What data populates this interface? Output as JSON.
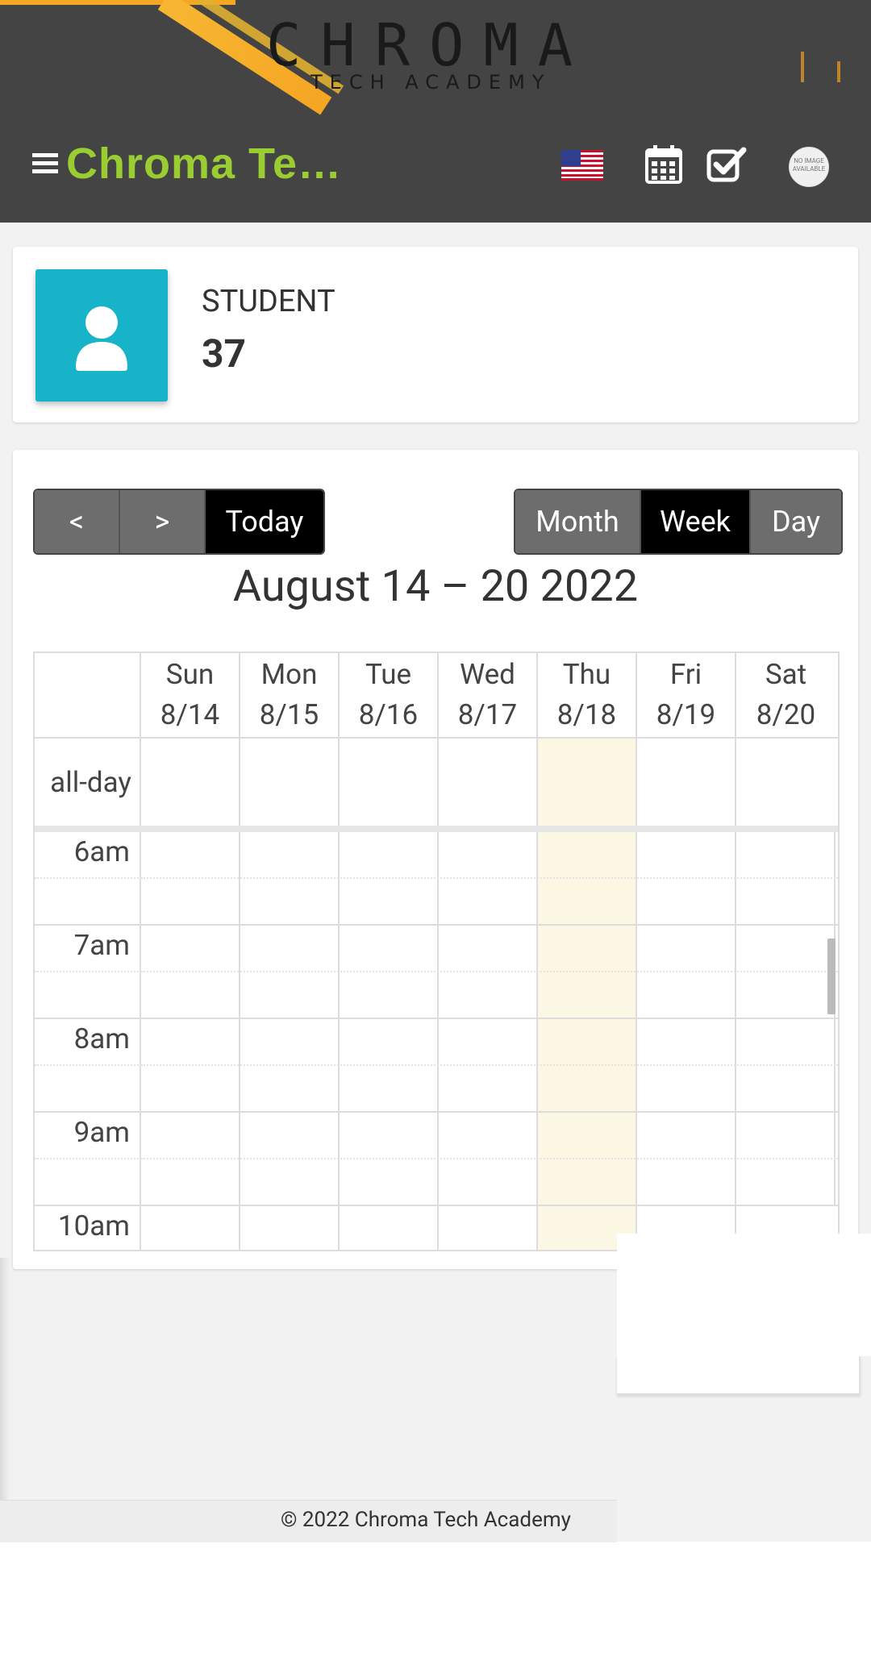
{
  "header": {
    "logo_main": "CHROMA",
    "logo_sub": "TECH ACADEMY",
    "brand_title": "Chroma Te…",
    "icons": [
      "menu-icon",
      "us-flag-icon",
      "calendar-icon",
      "checkbox-icon",
      "avatar-icon"
    ],
    "avatar_text": "NO IMAGE AVAILABLE"
  },
  "stat": {
    "label": "STUDENT",
    "value": "37",
    "accent_color": "#17b3c8"
  },
  "calendar": {
    "prev_label": "<",
    "next_label": ">",
    "today_label": "Today",
    "view_month": "Month",
    "view_week": "Week",
    "view_day": "Day",
    "active_view": "Week",
    "title": "August 14 – 20 2022",
    "allday_label": "all-day",
    "days": [
      {
        "name": "Sun",
        "date": "8/14"
      },
      {
        "name": "Mon",
        "date": "8/15"
      },
      {
        "name": "Tue",
        "date": "8/16"
      },
      {
        "name": "Wed",
        "date": "8/17"
      },
      {
        "name": "Thu",
        "date": "8/18"
      },
      {
        "name": "Fri",
        "date": "8/19"
      },
      {
        "name": "Sat",
        "date": "8/20"
      }
    ],
    "today_index": 4,
    "hours": [
      "6am",
      "7am",
      "8am",
      "9am",
      "10am"
    ]
  },
  "footer": {
    "copyright": "© 2022 Chroma Tech Academy"
  },
  "colors": {
    "header_bg": "#444444",
    "brand_green": "#9acd32",
    "accent_orange": "#f5a623",
    "today_highlight": "#fcf7e3"
  }
}
